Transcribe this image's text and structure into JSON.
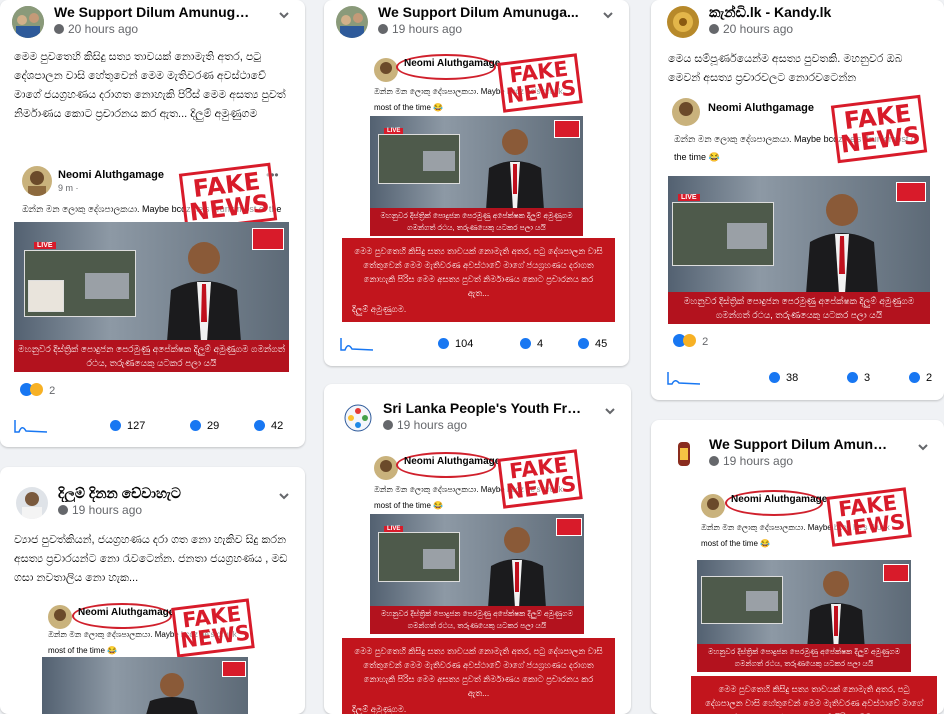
{
  "colors": {
    "fb_blue": "#1877f2",
    "fake_red": "#d81b2a",
    "news_red": "#c2151d",
    "background": "#f0f2f5",
    "muted": "#65676b"
  },
  "embed": {
    "name": "Neomi Aluthgamage",
    "time": "9 m · ",
    "text": "ඔන්න මන ලොකු දේශපාලකයා. Maybe bcoz he's drunk most of the time 😂",
    "ticker": "මහනුවර දිස්ත්‍රික් පොදුජන පෙරමුණු අපේක්ෂක දිලුම් අමුණුගම ගමන්ගත් රථය, තරුණයෙකු යටකර පලා යයි",
    "fake_line1": "FAKE",
    "fake_line2": "NEWS",
    "live": "LIVE",
    "red_text": "මෙම පුවතෙහි කිසිදු සත්‍ය තාවයක් නොමැති අතර, පටු දේශපාලන වාසි තේතුවෙන් මෙම මැතිවරණ අවස්ථාවේ මාගේ ජයග්‍රහණය දරාගත නොහැකි පිරිස මෙම අසත්‍ය පුවත් නිර්මාණය කොට ප්‍රචාරනය කර ඇත...",
    "red_sig": "දිලුම් අමුණුගම."
  },
  "posts": [
    {
      "page": "We Support Dilum Amunuga...",
      "time": "20 hours ago",
      "text": "මෙම පුවතෙහි කිසිදු සත්‍ය තාවයක් නොමැති අතර, පටු දේශපාලන වාසි හේතුවෙන් මෙම මැතිවරණ අවස්ථාවේ මාගේ ජයග්‍රහණය දරාගත නොහැකි පිරිස් මෙම අසත්‍ය පුවත් නිර්මාණය කොට ප්‍රචාරනය කර ඇත... දිලුම් අමුණුගම",
      "reaction_count": "2",
      "reactions": "127",
      "comments": "29",
      "shares": "42"
    },
    {
      "page": "We Support Dilum Amunuga...",
      "time": "19 hours ago",
      "reactions": "104",
      "comments": "4",
      "shares": "45"
    },
    {
      "page": "කැන්ඩි.lk - Kandy.lk",
      "time": "20 hours ago",
      "text": "මෙය සම්පූර්ණයෙන්ම අසත්‍ය පුවතකි. මහනුවර ඔබ මෙවන් අසත්‍ය ප්‍රචාරවලට නොරවටෙන්න",
      "reaction_count": "2",
      "reactions": "38",
      "comments": "3",
      "shares": "2"
    },
    {
      "page": "දිලුම් දිනන චේවාහැට",
      "time": "19 hours ago",
      "text": "ව්‍යාජ පුවත්කියන්, ජයග්‍රහණය දරා ගත නො හැකිව සිදු කරන අසත්‍ය ප්‍රචාරයන්ට නො රැවටෙන්න. ජනතා ජයග්‍රහණය , මඩ ගසා නවතාලිය නො හැක..."
    },
    {
      "page": "Sri Lanka People's Youth Fro...",
      "time": "19 hours ago"
    },
    {
      "page": "We Support Dilum Amunuga...",
      "time": "19 hours ago",
      "red_text": "මෙම පුවතෙහි කිසිදු සත්‍ය තාවයක් නොමැති අතර, පටු දේශපාලන වාසි හේතුවෙන් මෙම මැතිවරණ අවස්ථාවේ මාගේ ජයග්‍රහණය දරාගත නොහැකි පිරිස මෙම අසත්‍ය"
    }
  ]
}
